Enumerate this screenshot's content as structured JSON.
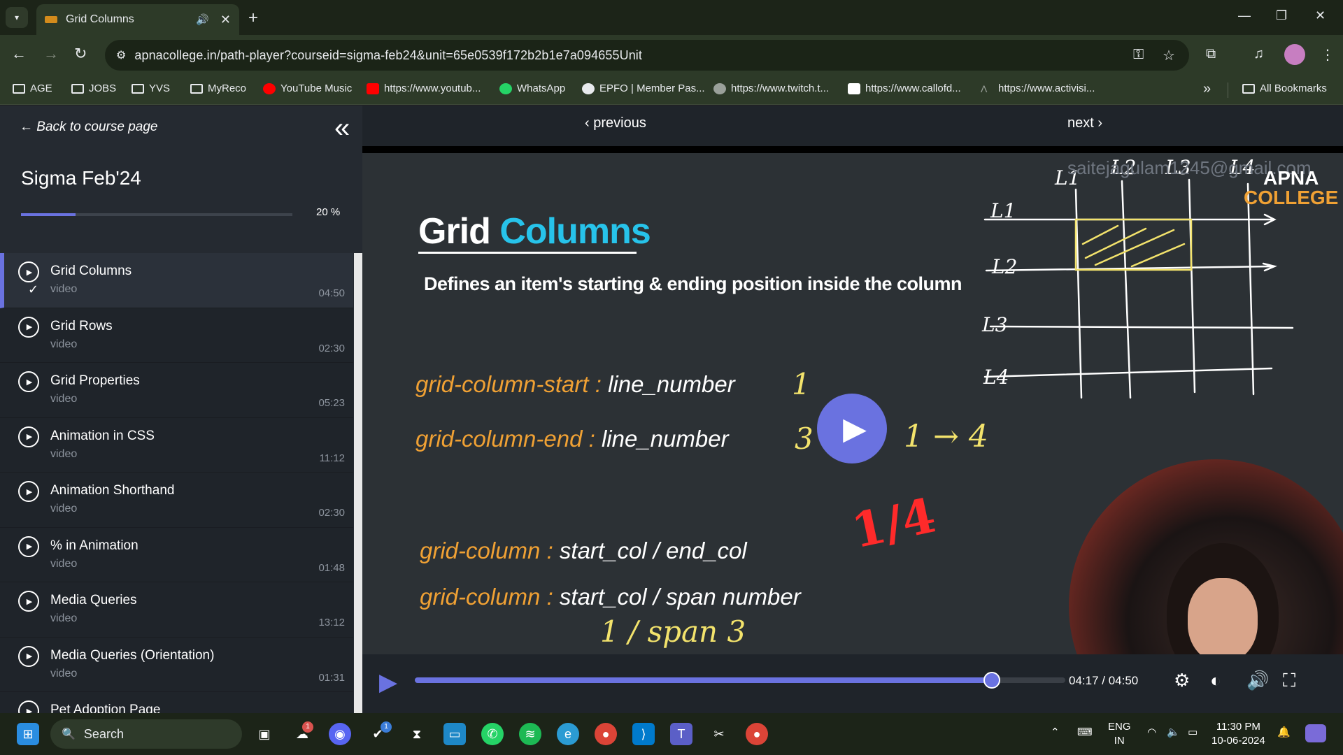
{
  "browser": {
    "tab": {
      "title": "Grid Columns"
    },
    "url": "apnacollege.in/path-player?courseid=sigma-feb24&unit=65e0539f172b2b1e7a094655Unit",
    "bookmarks": [
      "AGE",
      "JOBS",
      "YVS",
      "MyReco",
      "YouTube Music",
      "https://www.youtub...",
      "WhatsApp",
      "EPFO | Member Pas...",
      "https://www.twitch.t...",
      "https://www.callofd...",
      "https://www.activisi..."
    ],
    "all_bookmarks": "All Bookmarks"
  },
  "sidebar": {
    "back_label": "Back to course page",
    "course_title": "Sigma Feb'24",
    "progress": 20,
    "progress_label": "20 %",
    "lessons": [
      {
        "title": "Grid Columns",
        "type": "video",
        "duration": "04:50",
        "active": true,
        "completed": true
      },
      {
        "title": "Grid Rows",
        "type": "video",
        "duration": "02:30"
      },
      {
        "title": "Grid Properties",
        "type": "video",
        "duration": "05:23"
      },
      {
        "title": "Animation in CSS",
        "type": "video",
        "duration": "11:12"
      },
      {
        "title": "Animation Shorthand",
        "type": "video",
        "duration": "02:30"
      },
      {
        "title": "% in Animation",
        "type": "video",
        "duration": "01:48"
      },
      {
        "title": "Media Queries",
        "type": "video",
        "duration": "13:12"
      },
      {
        "title": "Media Queries (Orientation)",
        "type": "video",
        "duration": "01:31"
      },
      {
        "title": "Pet Adoption Page",
        "type": "",
        "duration": ""
      }
    ]
  },
  "player": {
    "prev_label": "previous",
    "next_label": "next",
    "slide": {
      "title_white": "Grid",
      "title_accent": "Columns",
      "subtitle": "Defines an item's starting & ending position inside the column",
      "lines": [
        {
          "prop": "grid-column-start :",
          "val": "line_number"
        },
        {
          "prop": "grid-column-end :",
          "val": "line_number"
        },
        {
          "prop": "grid-column :",
          "val": "start_col /  end_col"
        },
        {
          "prop": "grid-column :",
          "val": "start_col /  span number"
        }
      ],
      "handwriting": {
        "one": "1",
        "three": "3",
        "one_to_four": "1 → 4",
        "span": "1 / span 3",
        "red": "1/4",
        "col_labels": [
          "L1",
          "L2",
          "L3",
          "L4"
        ],
        "row_labels": [
          "L1",
          "L2",
          "L3",
          "L4"
        ]
      },
      "watermark": "saitejagulam1245@gmail.com",
      "brand_top": "APNA",
      "brand_bottom": "COLLEGE"
    },
    "current_time": "04:17",
    "duration": "04:50",
    "time_label": "04:17 / 04:50",
    "played_fraction": 0.887
  },
  "taskbar": {
    "search_placeholder": "Search",
    "lang_top": "ENG",
    "lang_bottom": "IN",
    "time": "11:30 PM",
    "date": "10-06-2024"
  }
}
